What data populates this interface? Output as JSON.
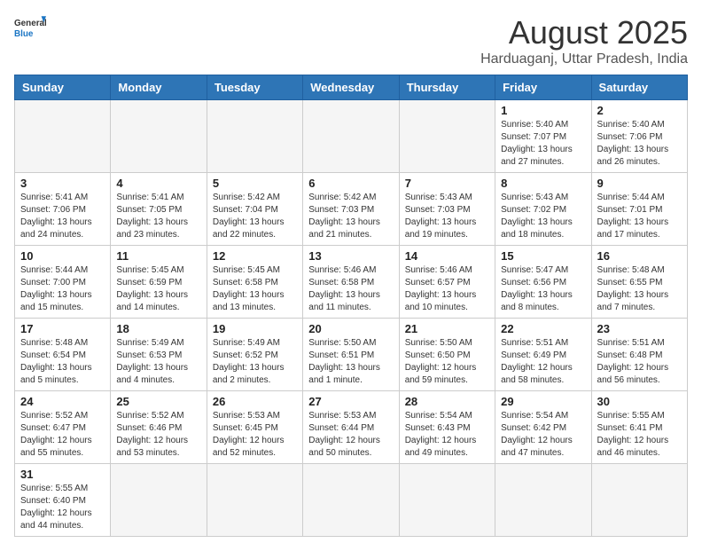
{
  "header": {
    "logo_general": "General",
    "logo_blue": "Blue",
    "month_title": "August 2025",
    "location": "Harduaganj, Uttar Pradesh, India"
  },
  "weekdays": [
    "Sunday",
    "Monday",
    "Tuesday",
    "Wednesday",
    "Thursday",
    "Friday",
    "Saturday"
  ],
  "weeks": [
    [
      {
        "day": "",
        "info": ""
      },
      {
        "day": "",
        "info": ""
      },
      {
        "day": "",
        "info": ""
      },
      {
        "day": "",
        "info": ""
      },
      {
        "day": "",
        "info": ""
      },
      {
        "day": "1",
        "info": "Sunrise: 5:40 AM\nSunset: 7:07 PM\nDaylight: 13 hours and 27 minutes."
      },
      {
        "day": "2",
        "info": "Sunrise: 5:40 AM\nSunset: 7:06 PM\nDaylight: 13 hours and 26 minutes."
      }
    ],
    [
      {
        "day": "3",
        "info": "Sunrise: 5:41 AM\nSunset: 7:06 PM\nDaylight: 13 hours and 24 minutes."
      },
      {
        "day": "4",
        "info": "Sunrise: 5:41 AM\nSunset: 7:05 PM\nDaylight: 13 hours and 23 minutes."
      },
      {
        "day": "5",
        "info": "Sunrise: 5:42 AM\nSunset: 7:04 PM\nDaylight: 13 hours and 22 minutes."
      },
      {
        "day": "6",
        "info": "Sunrise: 5:42 AM\nSunset: 7:03 PM\nDaylight: 13 hours and 21 minutes."
      },
      {
        "day": "7",
        "info": "Sunrise: 5:43 AM\nSunset: 7:03 PM\nDaylight: 13 hours and 19 minutes."
      },
      {
        "day": "8",
        "info": "Sunrise: 5:43 AM\nSunset: 7:02 PM\nDaylight: 13 hours and 18 minutes."
      },
      {
        "day": "9",
        "info": "Sunrise: 5:44 AM\nSunset: 7:01 PM\nDaylight: 13 hours and 17 minutes."
      }
    ],
    [
      {
        "day": "10",
        "info": "Sunrise: 5:44 AM\nSunset: 7:00 PM\nDaylight: 13 hours and 15 minutes."
      },
      {
        "day": "11",
        "info": "Sunrise: 5:45 AM\nSunset: 6:59 PM\nDaylight: 13 hours and 14 minutes."
      },
      {
        "day": "12",
        "info": "Sunrise: 5:45 AM\nSunset: 6:58 PM\nDaylight: 13 hours and 13 minutes."
      },
      {
        "day": "13",
        "info": "Sunrise: 5:46 AM\nSunset: 6:58 PM\nDaylight: 13 hours and 11 minutes."
      },
      {
        "day": "14",
        "info": "Sunrise: 5:46 AM\nSunset: 6:57 PM\nDaylight: 13 hours and 10 minutes."
      },
      {
        "day": "15",
        "info": "Sunrise: 5:47 AM\nSunset: 6:56 PM\nDaylight: 13 hours and 8 minutes."
      },
      {
        "day": "16",
        "info": "Sunrise: 5:48 AM\nSunset: 6:55 PM\nDaylight: 13 hours and 7 minutes."
      }
    ],
    [
      {
        "day": "17",
        "info": "Sunrise: 5:48 AM\nSunset: 6:54 PM\nDaylight: 13 hours and 5 minutes."
      },
      {
        "day": "18",
        "info": "Sunrise: 5:49 AM\nSunset: 6:53 PM\nDaylight: 13 hours and 4 minutes."
      },
      {
        "day": "19",
        "info": "Sunrise: 5:49 AM\nSunset: 6:52 PM\nDaylight: 13 hours and 2 minutes."
      },
      {
        "day": "20",
        "info": "Sunrise: 5:50 AM\nSunset: 6:51 PM\nDaylight: 13 hours and 1 minute."
      },
      {
        "day": "21",
        "info": "Sunrise: 5:50 AM\nSunset: 6:50 PM\nDaylight: 12 hours and 59 minutes."
      },
      {
        "day": "22",
        "info": "Sunrise: 5:51 AM\nSunset: 6:49 PM\nDaylight: 12 hours and 58 minutes."
      },
      {
        "day": "23",
        "info": "Sunrise: 5:51 AM\nSunset: 6:48 PM\nDaylight: 12 hours and 56 minutes."
      }
    ],
    [
      {
        "day": "24",
        "info": "Sunrise: 5:52 AM\nSunset: 6:47 PM\nDaylight: 12 hours and 55 minutes."
      },
      {
        "day": "25",
        "info": "Sunrise: 5:52 AM\nSunset: 6:46 PM\nDaylight: 12 hours and 53 minutes."
      },
      {
        "day": "26",
        "info": "Sunrise: 5:53 AM\nSunset: 6:45 PM\nDaylight: 12 hours and 52 minutes."
      },
      {
        "day": "27",
        "info": "Sunrise: 5:53 AM\nSunset: 6:44 PM\nDaylight: 12 hours and 50 minutes."
      },
      {
        "day": "28",
        "info": "Sunrise: 5:54 AM\nSunset: 6:43 PM\nDaylight: 12 hours and 49 minutes."
      },
      {
        "day": "29",
        "info": "Sunrise: 5:54 AM\nSunset: 6:42 PM\nDaylight: 12 hours and 47 minutes."
      },
      {
        "day": "30",
        "info": "Sunrise: 5:55 AM\nSunset: 6:41 PM\nDaylight: 12 hours and 46 minutes."
      }
    ],
    [
      {
        "day": "31",
        "info": "Sunrise: 5:55 AM\nSunset: 6:40 PM\nDaylight: 12 hours and 44 minutes."
      },
      {
        "day": "",
        "info": ""
      },
      {
        "day": "",
        "info": ""
      },
      {
        "day": "",
        "info": ""
      },
      {
        "day": "",
        "info": ""
      },
      {
        "day": "",
        "info": ""
      },
      {
        "day": "",
        "info": ""
      }
    ]
  ]
}
